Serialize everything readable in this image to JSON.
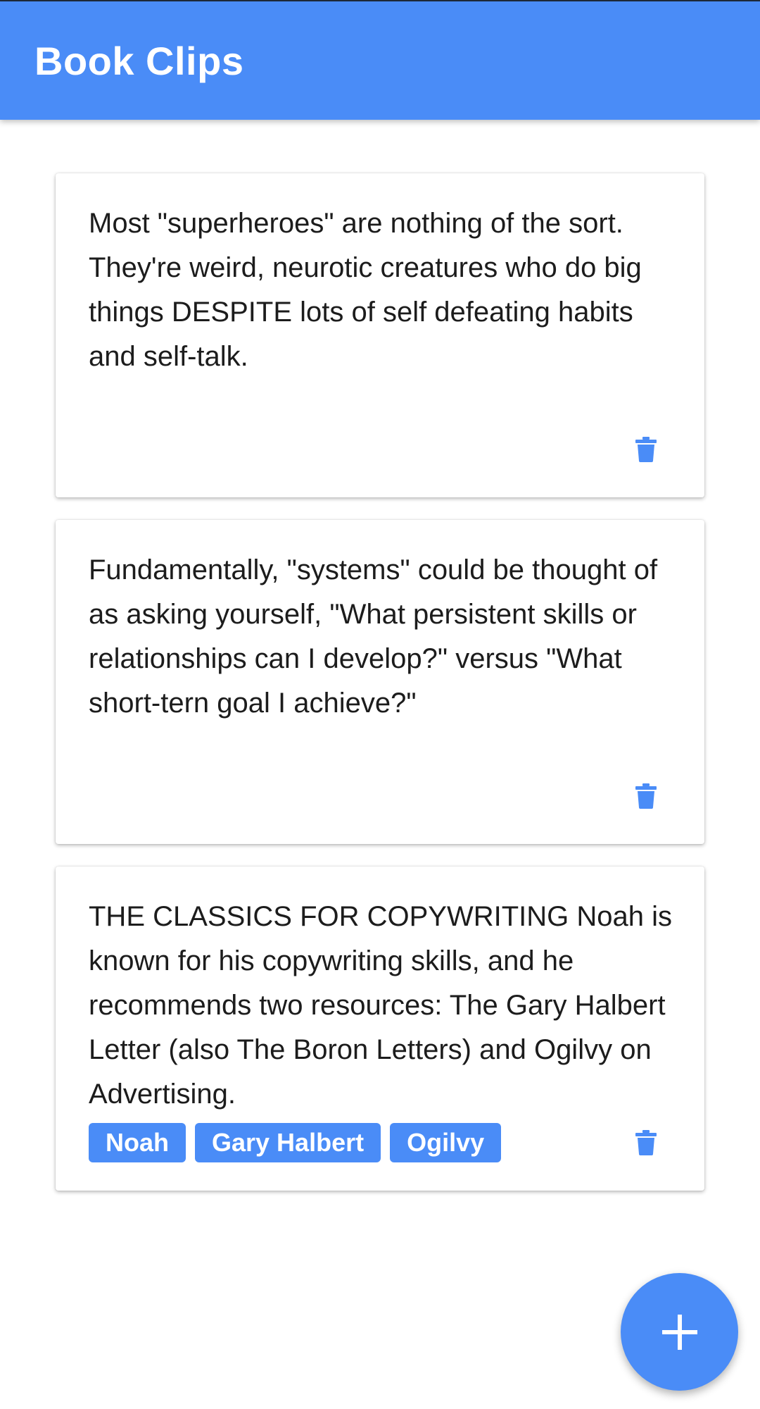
{
  "app_bar": {
    "title": "Book Clips",
    "color": "#4a8cf7"
  },
  "clips": [
    {
      "text": "Most \"superheroes\" are nothing of the sort. They're weird, neurotic creatures who do big things DESPITE lots of self defeating habits and self-talk.",
      "tags": [],
      "delete_icon": "trash-icon"
    },
    {
      "text": "Fundamentally, \"systems\" could be thought of as asking yourself, \"What persistent skills or relationships can I develop?\" versus \"What short-tern goal I achieve?\"",
      "tags": [],
      "delete_icon": "trash-icon"
    },
    {
      "text": "THE CLASSICS FOR COPYWRITING Noah is known for his copywriting skills, and he recommends two resources: The Gary Halbert Letter (also The Boron Letters) and Ogilvy on Advertising.",
      "tags": [
        "Noah",
        "Gary Halbert",
        "Ogilvy"
      ],
      "delete_icon": "trash-icon"
    }
  ],
  "fab": {
    "icon": "plus-icon",
    "color": "#4a8cf7"
  }
}
